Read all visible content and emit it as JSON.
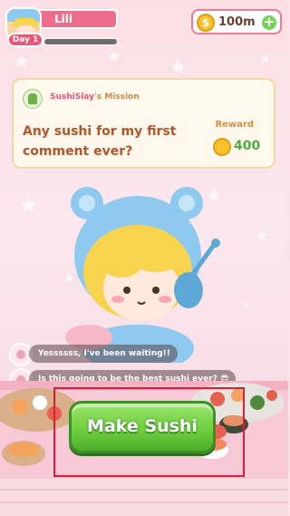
{
  "player": {
    "name": "Lili",
    "day": "Day 1",
    "day_progress": 0.0
  },
  "currency": {
    "amount": "100m",
    "add_label": "+"
  },
  "mission": {
    "user": "SushiSlay",
    "title_suffix": "'s Mission",
    "request": "Any sushi for my first comment ever?",
    "reward_label": "Reward",
    "reward_amount": "400"
  },
  "chat": [
    {
      "text": "Yessssss, I've been waiting!!"
    },
    {
      "text": "Is this going to be the best sushi ever? 😎"
    }
  ],
  "action": {
    "make_sushi_label": "Make Sushi"
  },
  "colors": {
    "accent_pink": "#ef6d8c",
    "button_green": "#6bcb3c",
    "highlight_red": "#e01b36"
  }
}
